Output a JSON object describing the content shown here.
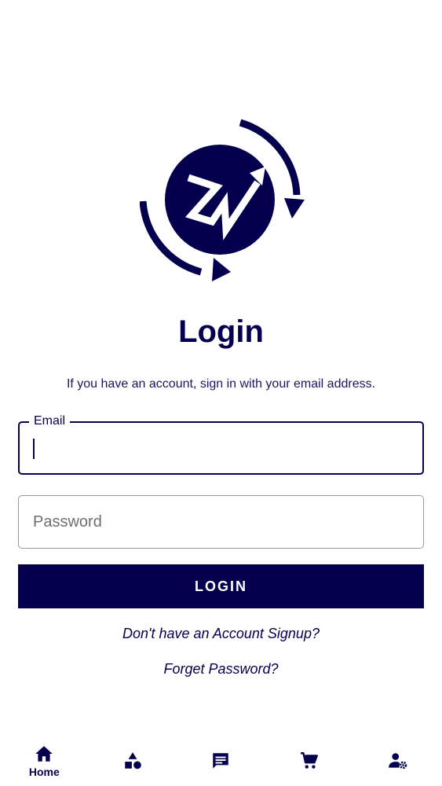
{
  "login": {
    "title": "Login",
    "subtitle": "If you have an account, sign in with your email address.",
    "email": {
      "label": "Email",
      "value": ""
    },
    "password": {
      "placeholder": "Password",
      "value": ""
    },
    "login_button": "LOGIN",
    "signup_link": "Don't have an Account Signup?",
    "forgot_link": "Forget Password?"
  },
  "bottom_nav": {
    "items": [
      {
        "icon": "home-icon",
        "label": "Home",
        "active": true
      },
      {
        "icon": "shapes-icon",
        "label": ""
      },
      {
        "icon": "message-icon",
        "label": ""
      },
      {
        "icon": "cart-icon",
        "label": ""
      },
      {
        "icon": "user-settings-icon",
        "label": ""
      }
    ]
  },
  "colors": {
    "brand": "#05004e",
    "background": "#ffffff",
    "placeholder": "#6f6f6f",
    "border_inactive": "#9a9a9a"
  }
}
